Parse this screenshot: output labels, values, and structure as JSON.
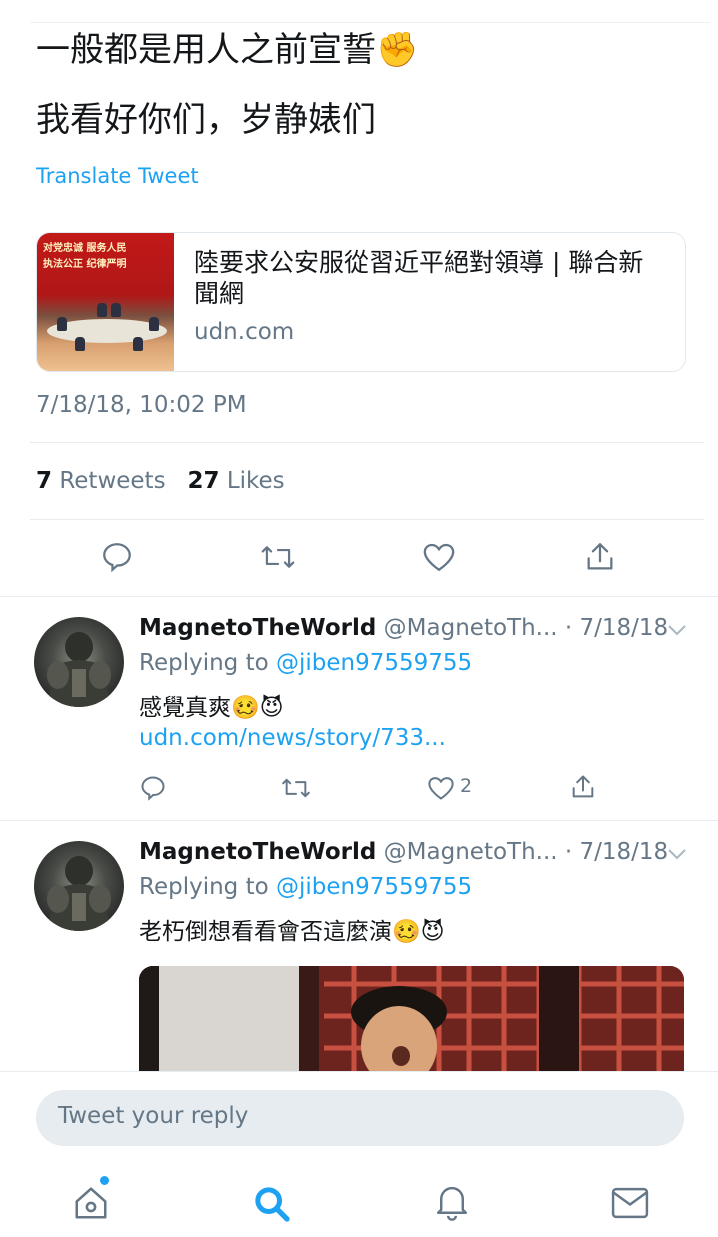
{
  "tweet": {
    "line1": "一般都是用人之前宣誓✊",
    "line2": "我看好你们，岁静婊们",
    "translate_label": "Translate Tweet",
    "card": {
      "image_banner_1": "对党忠诚 服务人民",
      "image_banner_2": "执法公正 纪律严明",
      "title": "陸要求公安服從習近平絕對領導 | 聯合新聞網",
      "domain": "udn.com"
    },
    "timestamp": "7/18/18, 10:02 PM",
    "retweet_count": "7",
    "retweet_label": "Retweets",
    "like_count": "27",
    "like_label": "Likes",
    "action_icons": [
      "reply-icon",
      "retweet-icon",
      "like-icon",
      "share-icon"
    ]
  },
  "replies": [
    {
      "name": "MagnetoTheWorld",
      "handle_date": "@MagnetoTh... · 7/18/18",
      "replying_prefix": "Replying to",
      "replying_to": "@jiben97559755",
      "text": "感覺真爽🥴😈",
      "link": "udn.com/news/story/733...",
      "like_count": "2"
    },
    {
      "name": "MagnetoTheWorld",
      "handle_date": "@MagnetoTh... · 7/18/18",
      "replying_prefix": "Replying to",
      "replying_to": "@jiben97559755",
      "text": "老朽倒想看看會否這麼演🥴😈"
    }
  ],
  "composer": {
    "placeholder": "Tweet your reply"
  },
  "tabbar": {
    "items": [
      "home-icon",
      "search-icon",
      "notifications-icon",
      "messages-icon"
    ],
    "accent": "#1da1f2"
  }
}
